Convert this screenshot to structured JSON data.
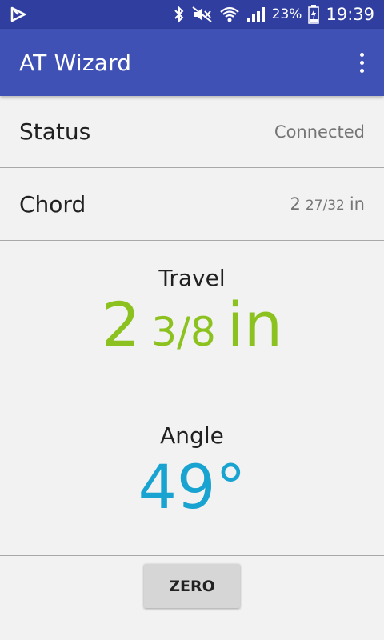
{
  "status_bar": {
    "battery": "23%",
    "time": "19:39",
    "icons": [
      "app-notification-icon",
      "bluetooth-icon",
      "mute-icon",
      "wifi-icon",
      "cell-signal-icon",
      "battery-charging-icon"
    ]
  },
  "app_bar": {
    "title": "AT Wizard",
    "menu_icon": "overflow-menu-icon"
  },
  "status_row": {
    "label": "Status",
    "value": "Connected"
  },
  "chord_row": {
    "label": "Chord",
    "whole": "2",
    "fraction": "27/32",
    "unit": "in"
  },
  "travel": {
    "label": "Travel",
    "whole": "2",
    "fraction": "3/8",
    "unit": "in",
    "color": "#8cc21f"
  },
  "angle": {
    "label": "Angle",
    "value": "49°",
    "color": "#18a3d0"
  },
  "zero_button": {
    "label": "ZERO"
  },
  "colors": {
    "status_bar": "#303f9f",
    "app_bar": "#3f51b5",
    "background": "#f2f2f2"
  }
}
